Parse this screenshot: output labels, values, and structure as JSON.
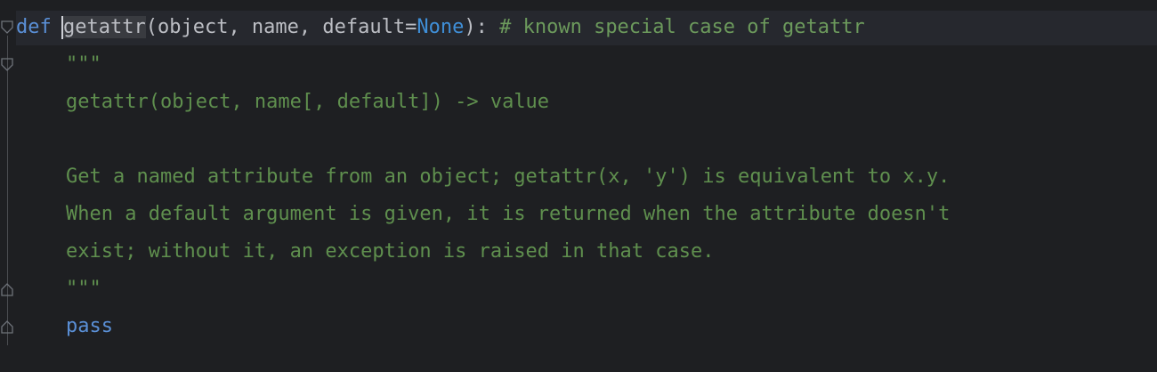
{
  "editor": {
    "language": "python",
    "colors": {
      "background": "#1e1f22",
      "current_line": "#26282e",
      "keyword": "#5a8fd6",
      "default_text": "#bcbec4",
      "comment": "#6c9a5c",
      "docstring": "#5f8f4e",
      "none_constant": "#3f8fd8"
    },
    "gutter_icons": [
      "fold-open-icon",
      "fold-open-icon",
      "fold-close-icon",
      "fold-close-icon"
    ],
    "lines": {
      "def": {
        "keyword": "def",
        "function_name": "getattr",
        "open_paren": "(",
        "params": "object, name, default=",
        "none_value": "None",
        "close": "):",
        "comment": "# known special case of getattr"
      },
      "doc_open": "\"\"\"",
      "doc_signature": "getattr(object, name[, default]) -> value",
      "doc_blank": "",
      "doc_line1": "Get a named attribute from an object; getattr(x, 'y') is equivalent to x.y.",
      "doc_line2": "When a default argument is given, it is returned when the attribute doesn't",
      "doc_line3": "exist; without it, an exception is raised in that case.",
      "doc_close": "\"\"\"",
      "body": "pass"
    }
  }
}
